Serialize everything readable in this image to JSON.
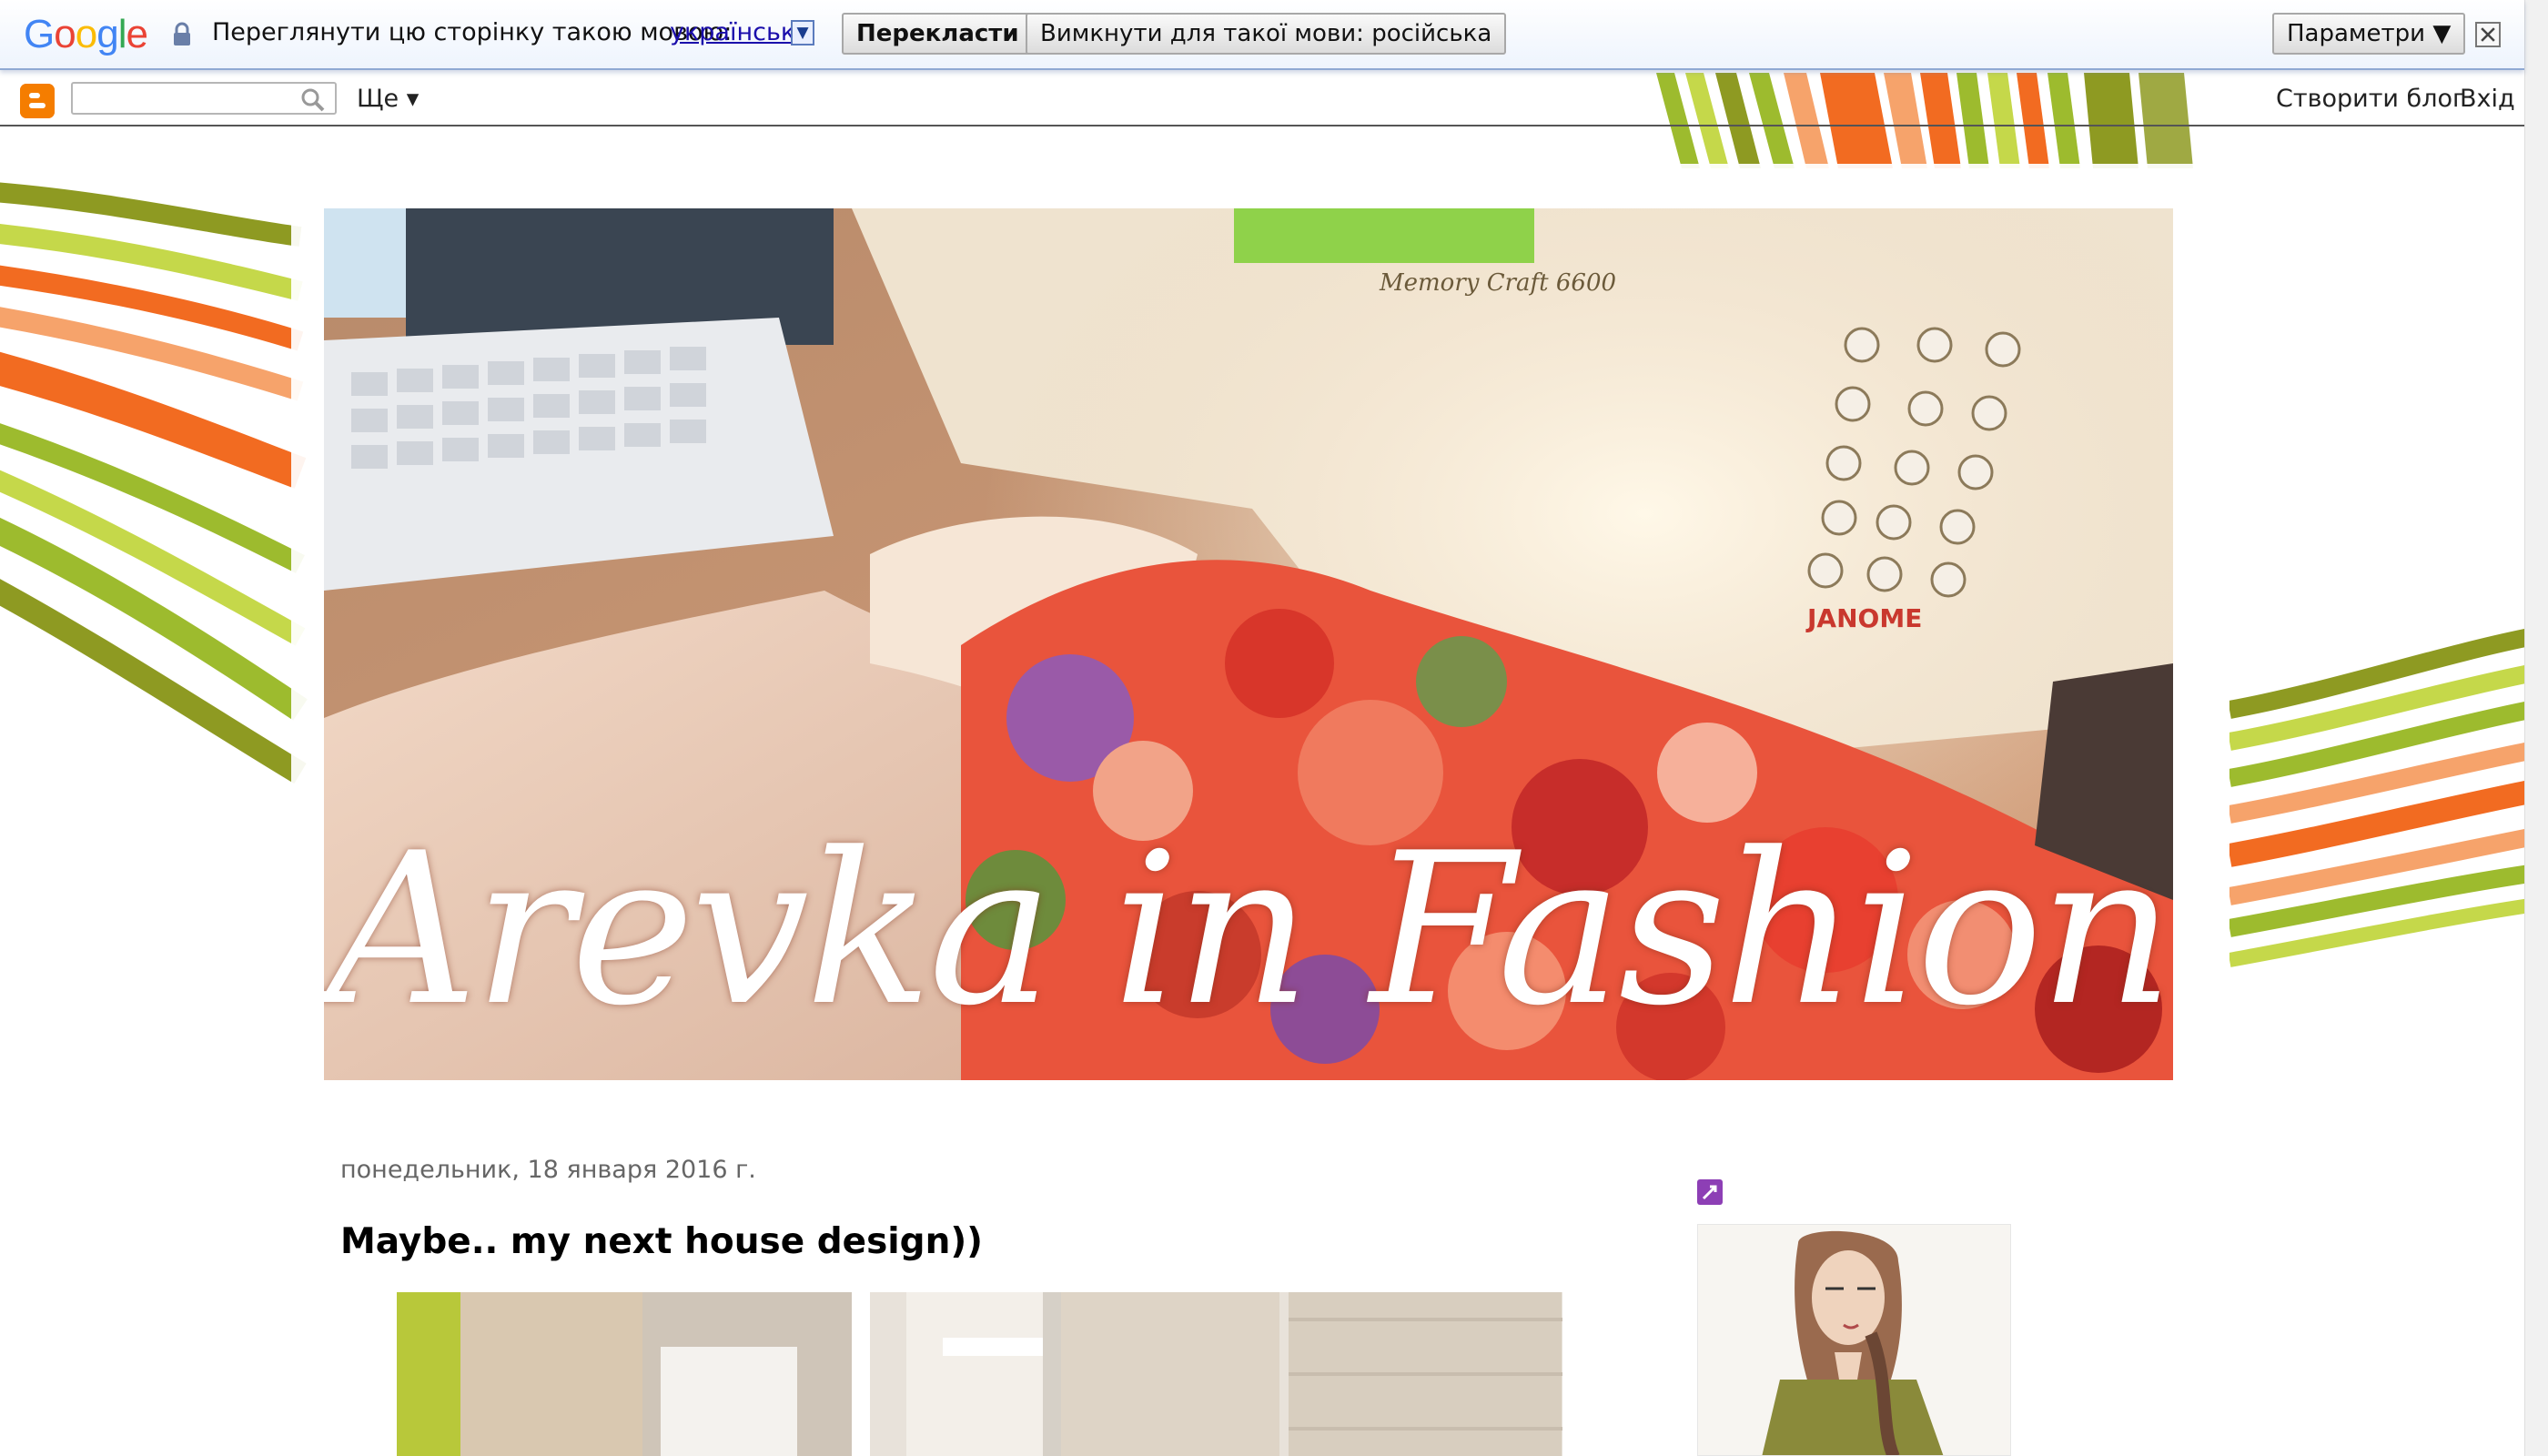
{
  "translate_bar": {
    "logo_letters": [
      "G",
      "o",
      "o",
      "g",
      "l",
      "e"
    ],
    "prompt": "Переглянути цю сторінку такою мовою:",
    "language": "українська",
    "translate_button": "Перекласти",
    "never_translate_button": "Вимкнути для такої мови: російська",
    "options_button": "Параметри ▼"
  },
  "navbar": {
    "search_value": "",
    "more_label": "Ще ▾",
    "create_blog": "Створити блог",
    "sign_in": "Вхід"
  },
  "header": {
    "title": "Arevka in Fashion",
    "machine_brand": "JANOME",
    "machine_model": "Memory Craft 6600"
  },
  "post": {
    "date": "понедельник, 18 января 2016 г.",
    "title": "Maybe.. my next house design))"
  },
  "colors": {
    "stripe_olive": "#8e9a22",
    "stripe_green": "#9dbb2e",
    "stripe_orange": "#f26b21",
    "stripe_light_orange": "#f6a36b",
    "stripe_lime": "#c5d84a"
  }
}
